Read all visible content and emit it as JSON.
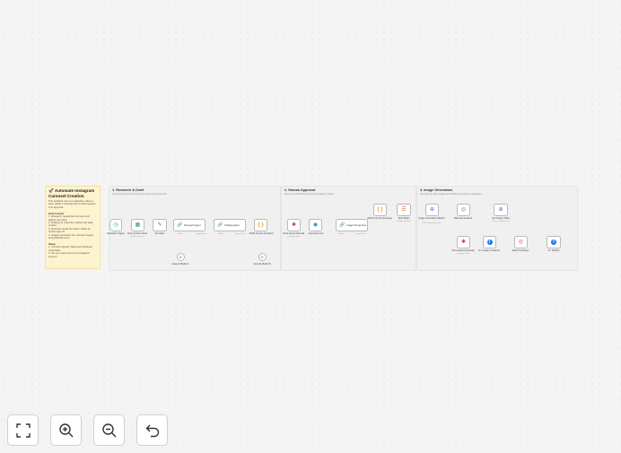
{
  "sticky_main": {
    "title": "Automate Instagram Carousel Creation",
    "intro": "This workflow runs on a schedule, takes a topic, drafts a carousel with AI and prepares it for approval.",
    "how_heading": "How it works",
    "how_items": [
      "1. Research: researches the topic and gathers key facts.",
      "2. Drafting: AI writes the caption and slide content.",
      "3. Approval: sends the draft to Slack for human sign off.",
      "4. Images: generates the carousel images and publishes them."
    ],
    "setup_heading": "Setup",
    "setup_items": [
      "1. Connect OpenAI, Slack and Facebook credentials.",
      "2. Set your topic source and Instagram account."
    ]
  },
  "sections": [
    {
      "title": "1. Research & Draft",
      "desc": "AI agents research the topic and create a structured draft."
    },
    {
      "title": "2. Human Approval",
      "desc": "Review the draft before generating images in Slack."
    },
    {
      "title": "3. Image Generation",
      "desc": "Generate the slide images and publish the carousel to Instagram."
    }
  ],
  "nodes": {
    "schedule_trigger": {
      "label": "Schedule Trigger",
      "icon": "clock-icon"
    },
    "find_content_ideas": {
      "label": "Find Content Ideas",
      "sub": "sheets: get rows",
      "icon": "sheets-icon"
    },
    "set_topic": {
      "label": "Set Topic",
      "icon": "pencil-icon"
    },
    "research_agent": {
      "label": "Research Agent",
      "icon": "link-icon"
    },
    "drafting_agent": {
      "label": "Drafting Agent",
      "icon": "link-icon"
    },
    "json_format_content": {
      "label": "JSON Format (Content)",
      "icon": "braces-icon"
    },
    "send_approval_email": {
      "label": "Send Approval Email",
      "sub": "message: send",
      "icon": "slack-icon"
    },
    "approval_loop": {
      "label": "Approval Loop",
      "icon": "eye-icon"
    },
    "image_prompt_gen": {
      "label": "Image Prompt Gen",
      "icon": "link-icon"
    },
    "json_format_prompts": {
      "label": "JSON Format (Prompts)",
      "icon": "braces-icon"
    },
    "split_slides": {
      "label": "Split Slides",
      "sub": "Include: all items",
      "icon": "list-icon"
    },
    "image_generation": {
      "label": "Image Generation (Batch)",
      "sub": "POST: api.openai.com",
      "icon": "globe-icon"
    },
    "wait_generation": {
      "label": "Wait (Generation)",
      "icon": "timer-icon"
    },
    "get_image_url": {
      "label": "Get Image (URL)",
      "sub": "GET: api.openai.com",
      "icon": "globe-icon"
    },
    "send_approval_final": {
      "label": "Send Approval (Final)",
      "sub": "message: send",
      "icon": "slack-icon"
    },
    "ig_create_container": {
      "label": "IG: Create Container",
      "icon": "facebook-icon"
    },
    "wait_container": {
      "label": "Wait (Container)",
      "icon": "timer-icon"
    },
    "ig_publish": {
      "label": "IG: Publish",
      "icon": "facebook-icon"
    },
    "openai_model_a": {
      "label": "OpenAI Model A",
      "icon": "openai-icon"
    },
    "openai_model_b": {
      "label": "OpenAI Model B",
      "icon": "openai-icon"
    }
  },
  "port_labels": {
    "model": "Model",
    "memory": "Memory",
    "tool": "Tool",
    "output_parser": "Output Parser"
  },
  "controls": [
    {
      "name": "fit-view-button",
      "icon": "fullscreen-icon"
    },
    {
      "name": "zoom-in-button",
      "icon": "zoom-in-icon"
    },
    {
      "name": "zoom-out-button",
      "icon": "zoom-out-icon"
    },
    {
      "name": "undo-button",
      "icon": "undo-icon"
    }
  ],
  "colors": {
    "accent": "#e06b6b",
    "sticky_yellow": "#fdf3cf",
    "sticky_grey": "#f0f0f0",
    "canvas": "#f4f4f4"
  }
}
